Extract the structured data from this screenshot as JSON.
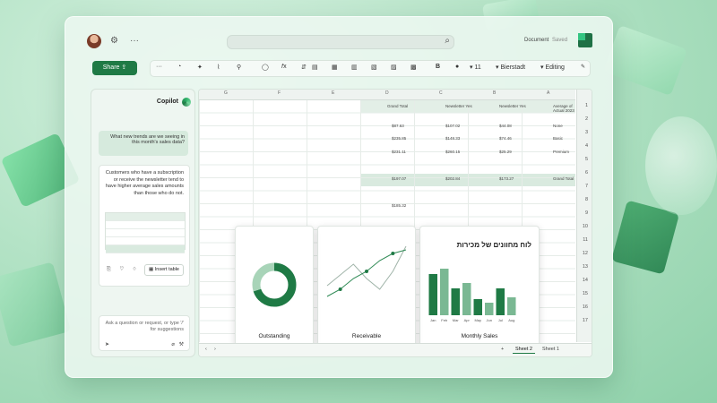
{
  "colors": {
    "accent": "#1f7a45",
    "light_accent": "#7ab893",
    "bg": "#b4e3c6"
  },
  "titlebar": {
    "doc_name": "Document",
    "doc_status": "Saved",
    "more_label": "···",
    "icons": [
      "avatar",
      "settings-icon",
      "search-icon",
      "excel-logo-icon"
    ]
  },
  "ribbon": {
    "share_label": "Share",
    "font_name": "Bierstadt",
    "font_size": "11",
    "editing_label": "Editing",
    "more_label": "···"
  },
  "copilot": {
    "title": "Copilot",
    "user_message": "What new trends are we seeing in this month's sales data?",
    "ai_message": "Customers who have a subscription or receive the newsletter tend to have higher average sales amounts than those who do not.",
    "insert_label": "Insert table",
    "input_placeholder": "Ask a question or request, or type '/' for suggestions"
  },
  "sheet": {
    "columns": [
      "A",
      "B",
      "C",
      "D",
      "E",
      "F",
      "G"
    ],
    "rows": [
      "1",
      "2",
      "3",
      "4",
      "5",
      "6",
      "7",
      "8",
      "9",
      "10",
      "11",
      "12",
      "13",
      "14",
      "15",
      "16",
      "17"
    ],
    "header_cells": [
      "Average of Actual 2023",
      "Newsletter Yes",
      "Newsletter Yes",
      "Grand Total"
    ],
    "row_labels": [
      "None",
      "Basic",
      "Premium",
      "Grand Total"
    ],
    "values": [
      [
        "$44.08",
        "$107.02",
        "$87.63"
      ],
      [
        "$74.46",
        "$148.33",
        "$235.85"
      ],
      [
        "$25.29",
        "$260.15",
        "$231.11"
      ],
      [
        "$173.27",
        "$202.84",
        "$197.07"
      ]
    ],
    "extra_value": "$185.32",
    "tabs": [
      "Sheet 1",
      "Sheet 2"
    ]
  },
  "dashboard": {
    "title": "לוח מחוונים של מכירות",
    "cards": [
      {
        "label": "Monthly Sales"
      },
      {
        "label": "Receivable"
      },
      {
        "label": "Outstanding"
      }
    ]
  },
  "chart_data": [
    {
      "type": "bar",
      "title": "Monthly Sales",
      "categories": [
        "Jan",
        "Feb",
        "Mar",
        "Apr",
        "May",
        "Jun",
        "Jul",
        "Aug"
      ],
      "values": [
        230,
        260,
        150,
        180,
        90,
        70,
        150,
        100
      ],
      "ylim": [
        0,
        300
      ]
    },
    {
      "type": "line",
      "title": "Receivable",
      "x": [
        1,
        2,
        3,
        4,
        5,
        6,
        7
      ],
      "series": [
        {
          "values": [
            40,
            55,
            70,
            50,
            35,
            60,
            95
          ]
        },
        {
          "values": [
            25,
            35,
            50,
            60,
            75,
            85,
            90
          ]
        }
      ]
    },
    {
      "type": "pie",
      "title": "Outstanding",
      "labels": [
        "a",
        "b"
      ],
      "values": [
        70,
        30
      ]
    }
  ]
}
